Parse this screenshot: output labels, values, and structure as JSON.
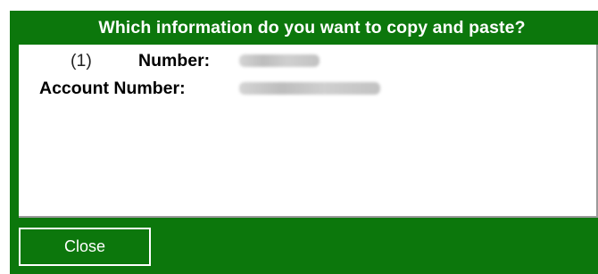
{
  "dialog": {
    "title": "Which information do you want to copy and paste?",
    "entries": [
      {
        "index": "(1)",
        "label": "Number:"
      },
      {
        "label": "Account Number:"
      }
    ],
    "close_label": "Close"
  },
  "colors": {
    "dialog_background": "#0c770c",
    "content_background": "#ffffff",
    "text": "#000000"
  }
}
